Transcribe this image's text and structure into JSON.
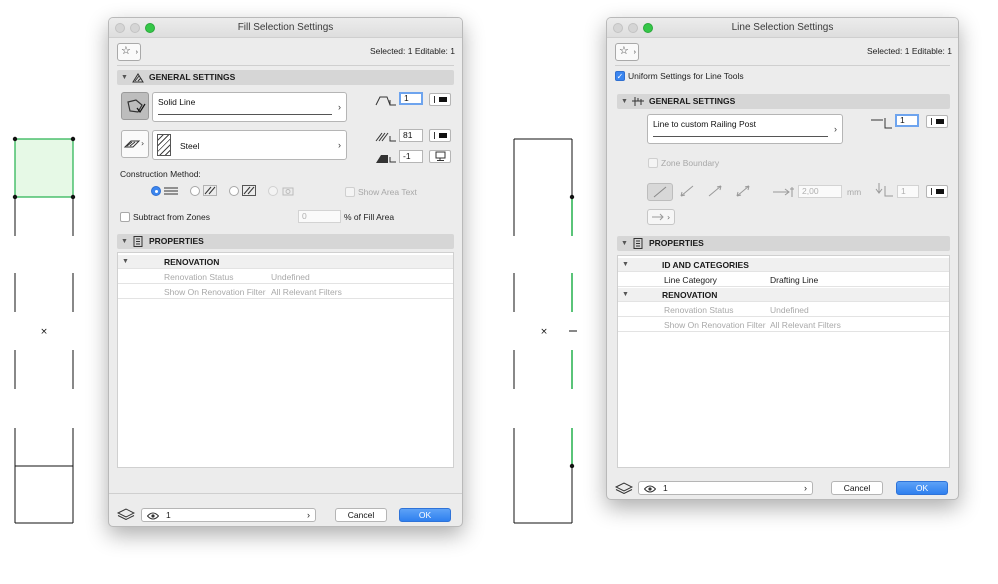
{
  "fill_window": {
    "title": "Fill Selection Settings",
    "selection_info": "Selected: 1 Editable: 1",
    "general_settings": {
      "header": "GENERAL SETTINGS",
      "line_type": "Solid Line",
      "fill_pen": "1",
      "fill_type": "Steel",
      "background_pen": "81",
      "pen_override": "-1",
      "construction_method_label": "Construction Method:",
      "show_area_text": "Show Area Text",
      "subtract_from_zones": "Subtract from Zones",
      "fill_area_value": "0",
      "fill_area_label": "% of Fill Area"
    },
    "properties": {
      "header": "PROPERTIES",
      "groups": [
        {
          "name": "RENOVATION",
          "rows": [
            {
              "key": "Renovation Status",
              "value": "Undefined"
            },
            {
              "key": "Show On Renovation Filter",
              "value": "All Relevant Filters"
            }
          ]
        }
      ]
    },
    "footer": {
      "layer_value": "1",
      "cancel": "Cancel",
      "ok": "OK"
    }
  },
  "line_window": {
    "title": "Line Selection Settings",
    "selection_info": "Selected: 1 Editable: 1",
    "uniform_settings": "Uniform Settings for Line Tools",
    "general_settings": {
      "header": "GENERAL SETTINGS",
      "line_type": "Line to custom Railing Post",
      "line_pen": "1",
      "zone_boundary": "Zone Boundary",
      "arrow_size": "2,00",
      "arrow_unit": "mm",
      "arrow_pen": "1"
    },
    "properties": {
      "header": "PROPERTIES",
      "groups": [
        {
          "name": "ID AND CATEGORIES",
          "rows": [
            {
              "key": "Line Category",
              "value": "Drafting Line"
            }
          ]
        },
        {
          "name": "RENOVATION",
          "rows": [
            {
              "key": "Renovation Status",
              "value": "Undefined"
            },
            {
              "key": "Show On Renovation Filter",
              "value": "All Relevant Filters"
            }
          ]
        }
      ]
    },
    "footer": {
      "layer_value": "1",
      "cancel": "Cancel",
      "ok": "OK"
    }
  },
  "colors": {
    "accent": "#3b86f0",
    "selected_fill": "#e6f9e6",
    "highlight_line": "#22b14c"
  }
}
